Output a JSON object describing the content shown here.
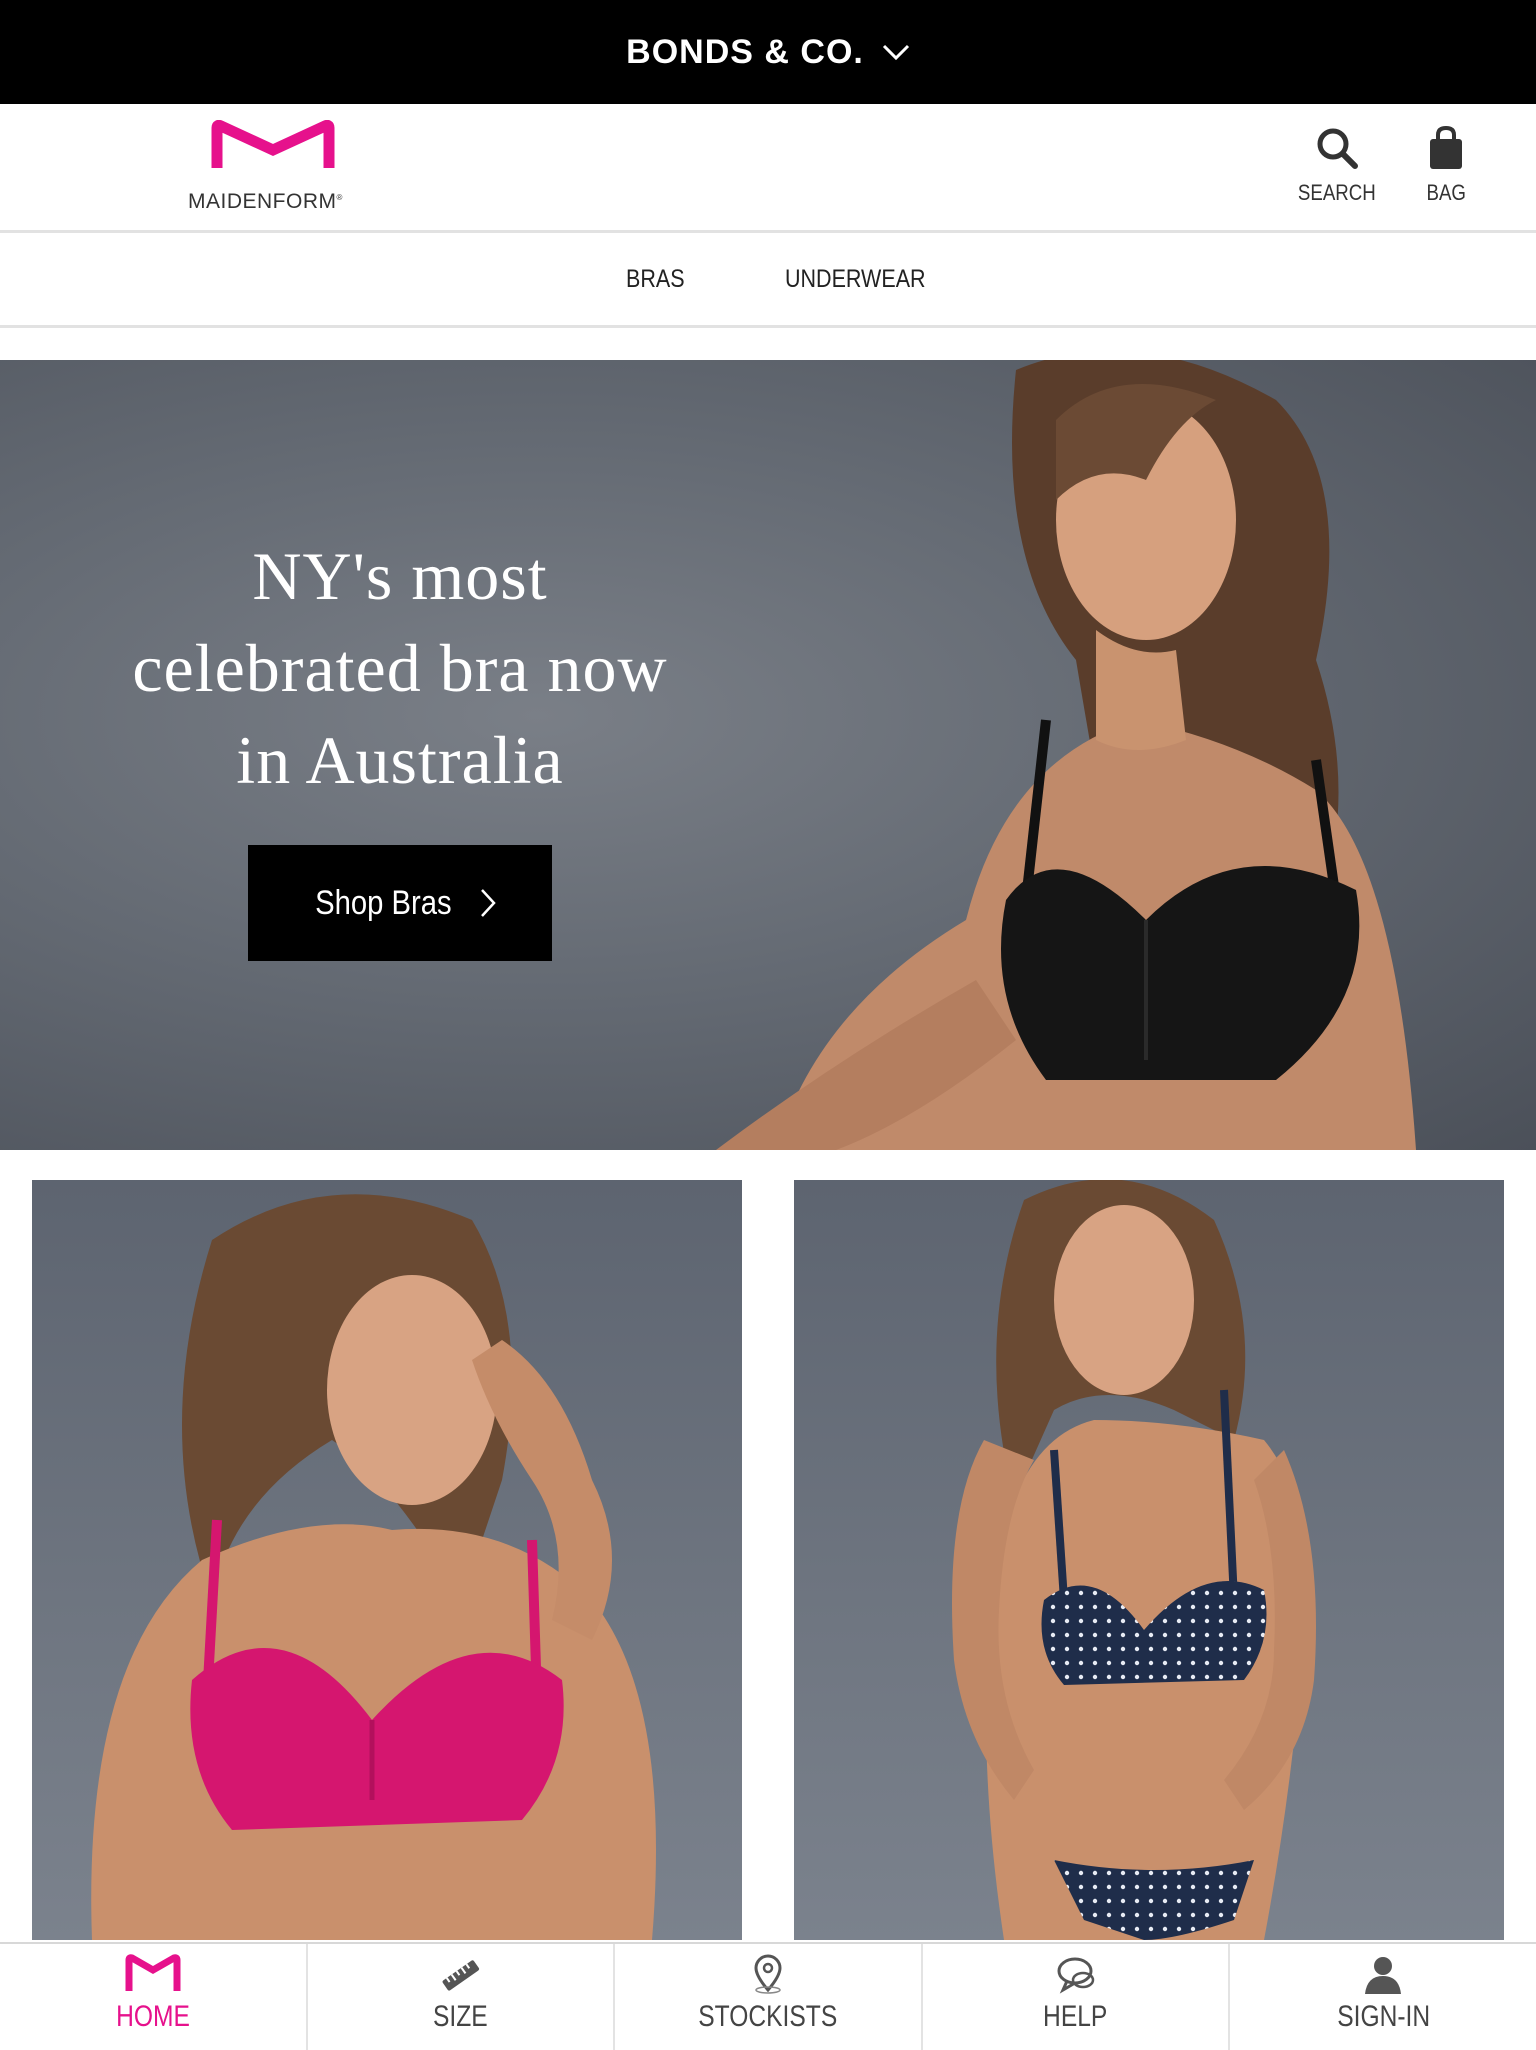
{
  "brand_bar": {
    "brand": "BONDS & CO."
  },
  "header": {
    "logo_text": "MAIDENFORM",
    "search_label": "SEARCH",
    "bag_label": "BAG"
  },
  "category_nav": [
    "BRAS",
    "UNDERWEAR"
  ],
  "hero": {
    "headline_lines": [
      "NY's most",
      "celebrated bra now",
      "in Australia"
    ],
    "cta_label": "Shop Bras"
  },
  "bottom_tabs": [
    {
      "label": "HOME",
      "icon": "maidenform-m-icon",
      "active": true
    },
    {
      "label": "SIZE",
      "icon": "ruler-icon",
      "active": false
    },
    {
      "label": "STOCKISTS",
      "icon": "map-pin-icon",
      "active": false
    },
    {
      "label": "HELP",
      "icon": "chat-bubble-icon",
      "active": false
    },
    {
      "label": "SIGN-IN",
      "icon": "user-icon",
      "active": false
    }
  ],
  "colors": {
    "accent": "#e6118c",
    "brand_bar": "#000000",
    "hero_bg": "#646a73"
  }
}
